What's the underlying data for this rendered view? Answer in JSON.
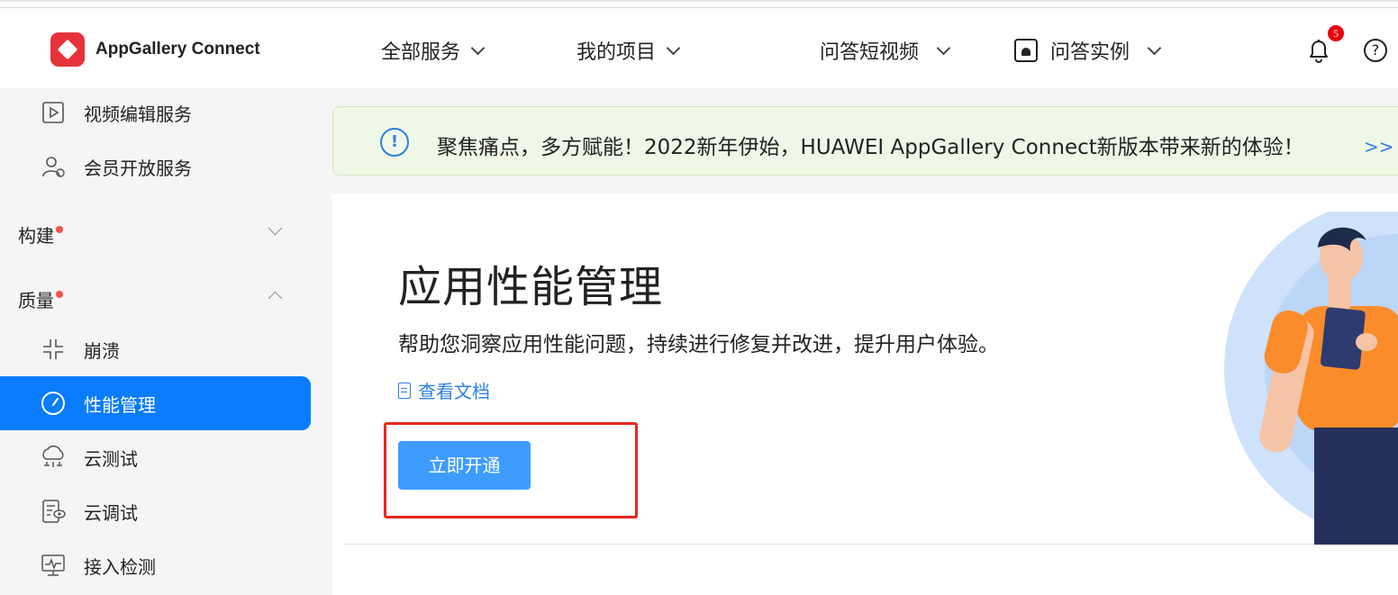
{
  "header": {
    "brand": "AppGallery Connect",
    "nav": [
      {
        "label": "全部服务"
      },
      {
        "label": "我的项目"
      },
      {
        "label": "问答短视频"
      },
      {
        "label": "问答实例"
      }
    ],
    "notification_count": "5",
    "help_icon_text": "?"
  },
  "sidebar": {
    "items_top": [
      {
        "label": "视频编辑服务",
        "icon": "video-edit-icon"
      },
      {
        "label": "会员开放服务",
        "icon": "member-icon"
      }
    ],
    "groups": [
      {
        "label": "构建",
        "expanded": false
      },
      {
        "label": "质量",
        "expanded": true
      }
    ],
    "quality_items": [
      {
        "label": "崩溃",
        "icon": "crash-icon"
      },
      {
        "label": "性能管理",
        "icon": "gauge-icon",
        "active": true
      },
      {
        "label": "云测试",
        "icon": "cloud-test-icon"
      },
      {
        "label": "云调试",
        "icon": "cloud-debug-icon"
      },
      {
        "label": "接入检测",
        "icon": "monitor-check-icon"
      }
    ]
  },
  "notice": {
    "icon_text": "!",
    "text": "聚焦痛点，多方赋能！2022新年伊始，HUAWEI AppGallery Connect新版本带来新的体验！",
    "link": ">> 了"
  },
  "main": {
    "title": "应用性能管理",
    "description": "帮助您洞察应用性能问题，持续进行修复并改进，提升用户体验。",
    "doc_link": "查看文档",
    "cta_label": "立即开通"
  },
  "colors": {
    "accent": "#0a7cff",
    "cta": "#3f9cff",
    "highlight_border": "#e8271f",
    "notice_bg": "#eff8e7"
  }
}
